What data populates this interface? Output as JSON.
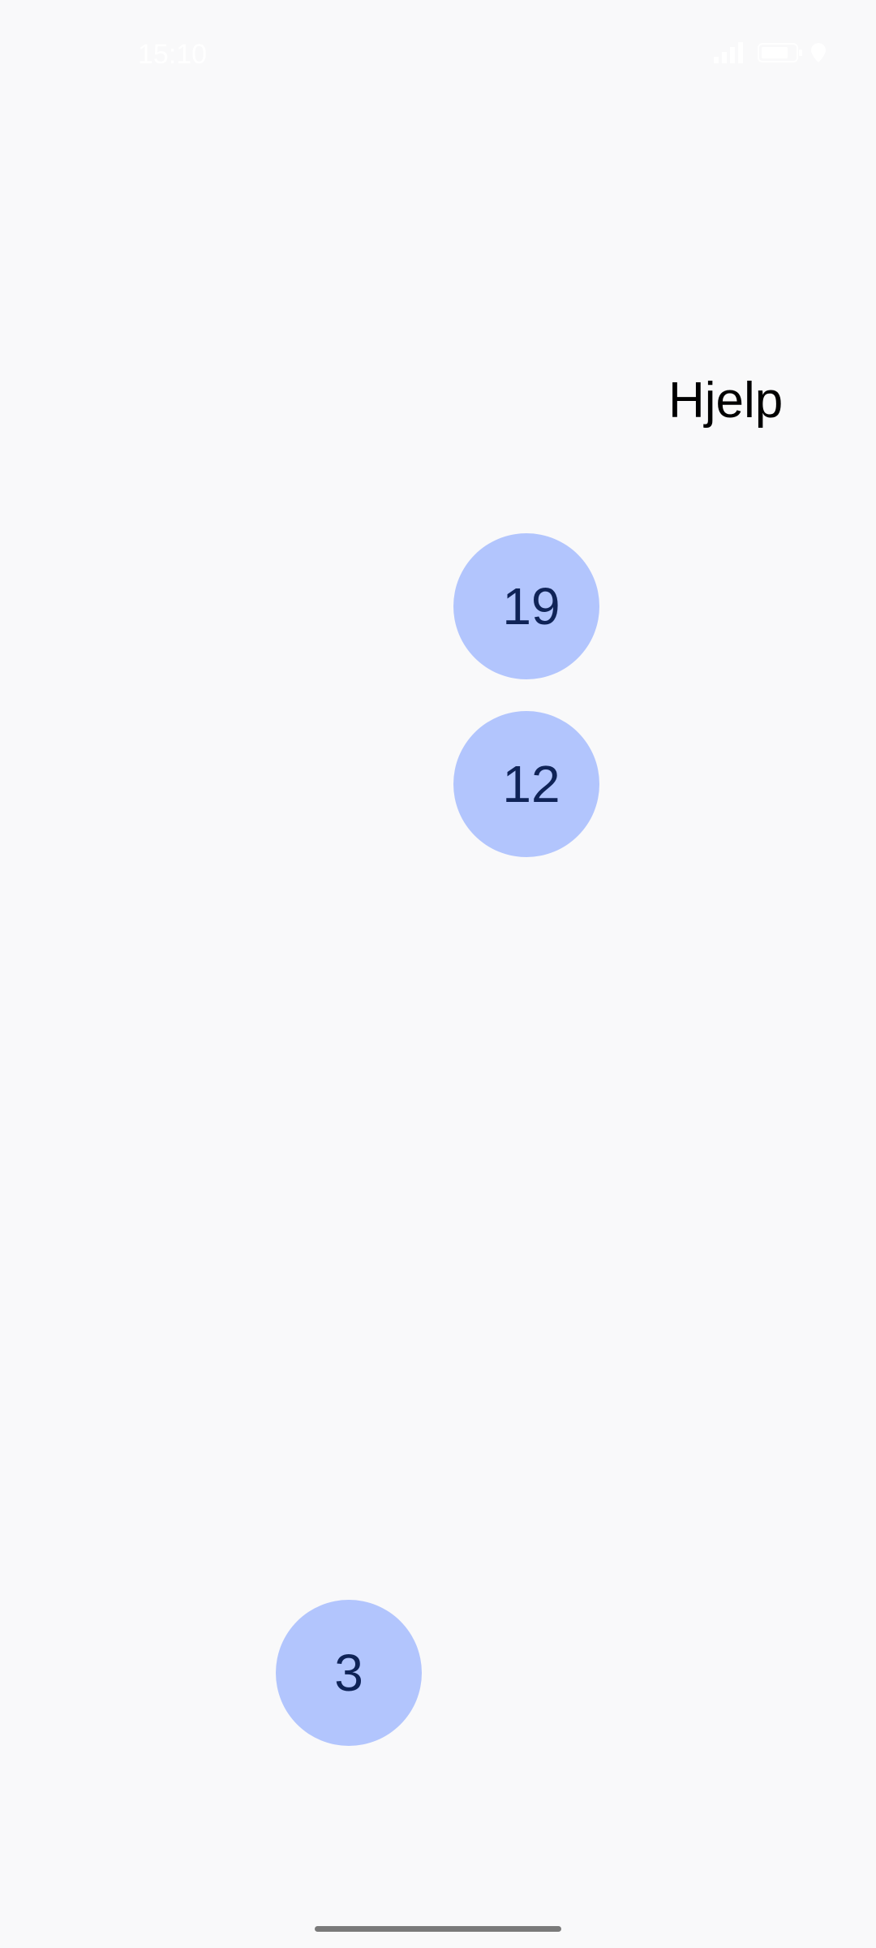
{
  "status_bar": {
    "time": "15:10",
    "icons": [
      "signal-icon",
      "battery-icon",
      "location-icon"
    ]
  },
  "help": {
    "label": "Hjelp"
  },
  "numbers": [
    {
      "label": "19"
    },
    {
      "label": "12"
    },
    {
      "label": "3"
    }
  ],
  "colors": {
    "background": "#f9f9fa",
    "circle": "#b2c5fd",
    "circle_text": "#0f2357",
    "help_text": "#000000"
  }
}
